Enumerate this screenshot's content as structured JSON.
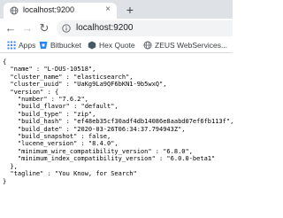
{
  "tab": {
    "title": "localhost:9200",
    "close_glyph": "×",
    "new_tab_glyph": "+"
  },
  "toolbar": {
    "back_glyph": "←",
    "forward_glyph": "→",
    "reload_glyph": "↻",
    "url": "localhost:9200"
  },
  "bookmarks": [
    {
      "label": "Apps",
      "icon": "apps-grid-icon",
      "color": "#4285f4"
    },
    {
      "label": "Bitbucket",
      "icon": "bitbucket-icon",
      "color": "#2684ff"
    },
    {
      "label": "Hex Quote",
      "icon": "hex-quote-icon",
      "color": "#455a64"
    },
    {
      "label": "ZEUS WebServices...",
      "icon": "globe-icon",
      "color": "#5f6368"
    }
  ],
  "json_lines": [
    "{",
    "  \"name\" : \"L-DUS-10518\",",
    "  \"cluster_name\" : \"elasticsearch\",",
    "  \"cluster_uuid\" : \"UaKg9La9QF6bKN1-9b5wxQ\",",
    "  \"version\" : {",
    "    \"number\" : \"7.6.2\",",
    "    \"build_flavor\" : \"default\",",
    "    \"build_type\" : \"zip\",",
    "    \"build_hash\" : \"ef48eb35cf30adf4db14086e8aabd07ef6fb113f\",",
    "    \"build_date\" : \"2020-03-26T06:34:37.794943Z\",",
    "    \"build_snapshot\" : false,",
    "    \"lucene_version\" : \"8.4.0\",",
    "    \"minimum_wire_compatibility_version\" : \"6.8.0\",",
    "    \"minimum_index_compatibility_version\" : \"6.0.0-beta1\"",
    "  },",
    "  \"tagline\" : \"You Know, for Search\"",
    "}"
  ]
}
